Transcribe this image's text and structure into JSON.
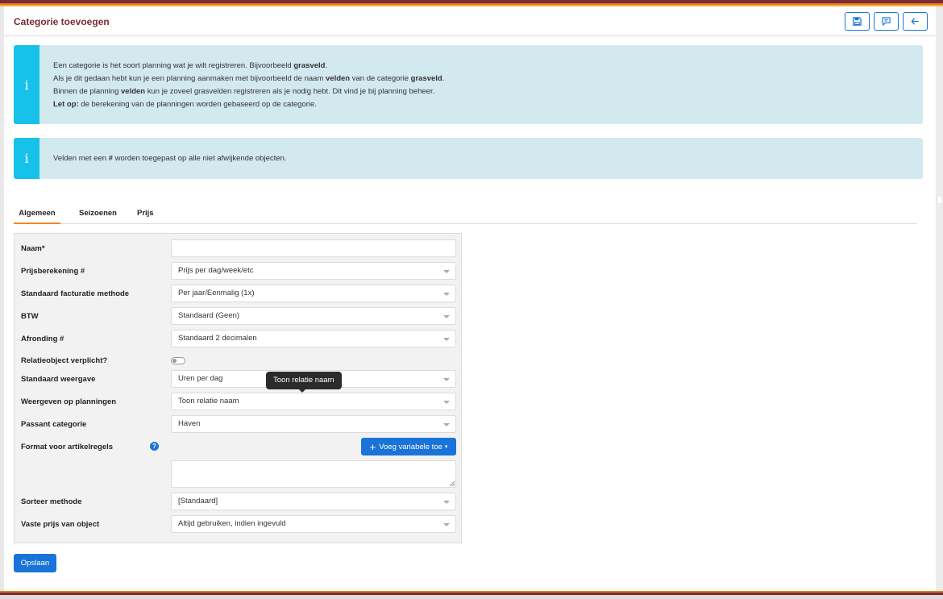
{
  "header": {
    "title": "Categorie toevoegen",
    "buttons": [
      {
        "icon": "save-icon"
      },
      {
        "icon": "comment-icon"
      },
      {
        "icon": "arrow-left-icon"
      }
    ]
  },
  "info_boxes": [
    {
      "icon": "i",
      "lines": [
        "Een categorie is het soort planning wat je wilt registreren. Bijvoorbeeld <b>grasveld</b>.",
        "Als je dit gedaan hebt kun je een planning aanmaken met bijvoorbeeld de naam <b>velden</b> van de categorie <b>grasveld</b>.",
        "Binnen de planning <b>velden</b> kun je zoveel grasvelden registreren als je nodig hebt. Dit vind je bij planning beheer.",
        "<b>Let op:</b> de berekening van de planningen worden gebaseerd op de categorie."
      ]
    },
    {
      "icon": "i",
      "lines": [
        "Velden met een <b>#</b> worden toegepast op alle niet afwijkende objecten."
      ]
    }
  ],
  "tabs": [
    {
      "label": "Algemeen",
      "active": true
    },
    {
      "label": "Seizoenen",
      "active": false
    },
    {
      "label": "Prijs",
      "active": false
    }
  ],
  "form": {
    "naam": {
      "label": "Naam*",
      "value": ""
    },
    "prijsberekening": {
      "label": "Prijsberekening #",
      "value": "Prijs per dag/week/etc"
    },
    "facturatie": {
      "label": "Standaard facturatie methode",
      "value": "Per jaar/Eenmalig (1x)"
    },
    "btw": {
      "label": "BTW",
      "value": "Standaard (Geen)"
    },
    "afronding": {
      "label": "Afronding #",
      "value": "Standaard 2 decimalen"
    },
    "relatieobject": {
      "label": "Relatieobject verplicht?",
      "checked": false
    },
    "weergave": {
      "label": "Standaard weergave",
      "value": "Uren per dag"
    },
    "weergeven": {
      "label": "Weergeven op planningen",
      "value": "Toon relatie naam"
    },
    "passant": {
      "label": "Passant categorie",
      "value": "Haven"
    },
    "format": {
      "label": "Format voor artikelregels",
      "help": "?",
      "add_button": "Voeg variabele toe",
      "value": ""
    },
    "sorteer": {
      "label": "Sorteer methode",
      "value": "[Standaard]"
    },
    "vaste_prijs": {
      "label": "Vaste prijs van object",
      "value": "Altijd gebruiken, indien ingevuld"
    }
  },
  "tooltip": "Toon relatie naam",
  "save_button": "Opslaan",
  "colors": {
    "accent": "#1a73d9",
    "brand": "#7a2a38",
    "info_bar": "#16c2ea",
    "info_bg": "#d2e9f0",
    "tab_underline": "#f08a24"
  }
}
